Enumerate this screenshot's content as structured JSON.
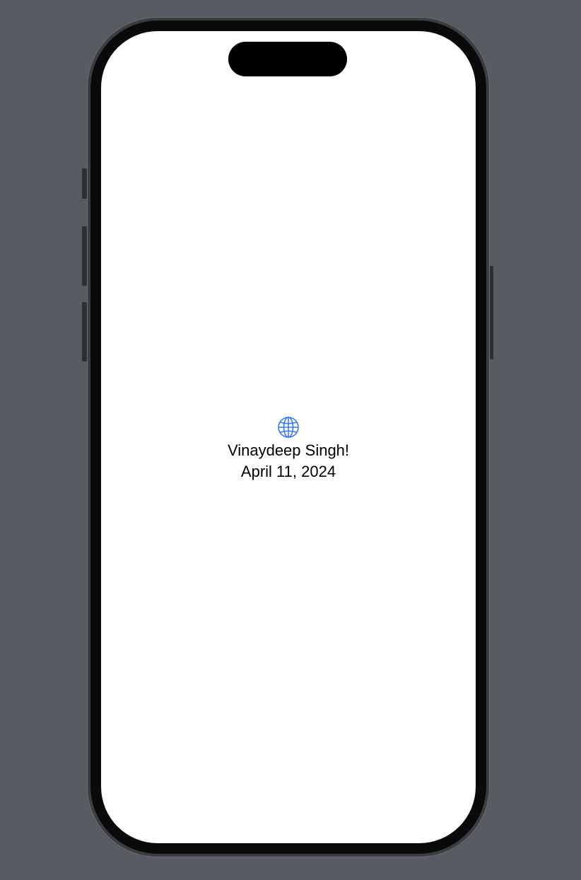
{
  "app": {
    "greeting": "Vinaydeep Singh!",
    "date": "April 11, 2024"
  },
  "icons": {
    "top_icon": "globe-icon"
  },
  "colors": {
    "accent": "#3478f6",
    "background": "#575b62",
    "screen": "#ffffff"
  }
}
